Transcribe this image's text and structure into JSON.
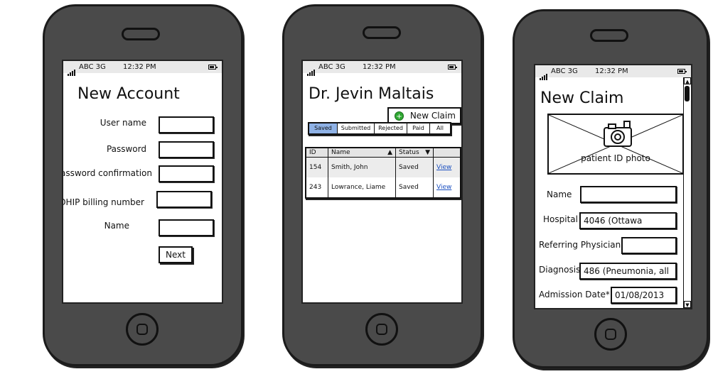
{
  "status_bar": {
    "carrier": "ABC 3G",
    "time": "12:32 PM"
  },
  "screen1": {
    "title": "New Account",
    "fields": [
      {
        "label": "User name",
        "value": ""
      },
      {
        "label": "Password",
        "value": ""
      },
      {
        "label": "Password confirmation",
        "value": ""
      },
      {
        "label": "OHIP billing number",
        "value": ""
      },
      {
        "label": "Name",
        "value": ""
      }
    ],
    "next_label": "Next"
  },
  "screen2": {
    "title": "Dr. Jevin Maltais",
    "new_claim_label": "New Claim",
    "new_claim_icon": "add-circle-icon",
    "tabs": [
      "Saved",
      "Submitted",
      "Rejected",
      "Paid",
      "All"
    ],
    "active_tab": "Saved",
    "columns": [
      "ID",
      "Name",
      "Status",
      ""
    ],
    "rows": [
      {
        "id": "154",
        "name": "Smith, John",
        "status": "Saved",
        "action": "View"
      },
      {
        "id": "243",
        "name": "Lowrance, Liame",
        "status": "Saved",
        "action": "View"
      }
    ]
  },
  "screen3": {
    "title": "New Claim",
    "photo_caption": "patient ID photo",
    "fields": [
      {
        "label": "Name",
        "value": ""
      },
      {
        "label": "Hospital",
        "value": "4046 (Ottawa"
      },
      {
        "label": "Referring Physician",
        "value": ""
      },
      {
        "label": "Diagnosis",
        "value": "486 (Pneumonia, all"
      },
      {
        "label": "Admission Date*",
        "value": "01/08/2013"
      }
    ]
  },
  "colors": {
    "phone_body": "#4a4a4a",
    "active_tab": "#8fb2e6",
    "link": "#1a4fc0",
    "add_icon": "#2fa832"
  }
}
